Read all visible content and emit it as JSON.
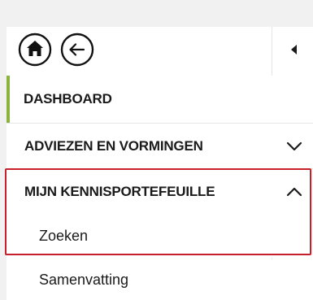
{
  "header": {
    "home_icon": "home-icon",
    "back_icon": "arrow-left-icon",
    "collapse_icon": "triangle-left-icon"
  },
  "nav": {
    "dashboard": {
      "label": "DASHBOARD",
      "active_indicator_color": "#8db33f"
    },
    "adviezen": {
      "label": "ADVIEZEN EN VORMINGEN",
      "expanded": false,
      "icon": "chevron-down-icon"
    },
    "mijn": {
      "label": "MIJN KENNISPORTEFEUILLE",
      "expanded": true,
      "icon": "chevron-up-icon",
      "children": [
        {
          "label": "Zoeken"
        },
        {
          "label": "Samenvatting"
        }
      ]
    }
  },
  "highlight": {
    "color": "#c8202a"
  }
}
